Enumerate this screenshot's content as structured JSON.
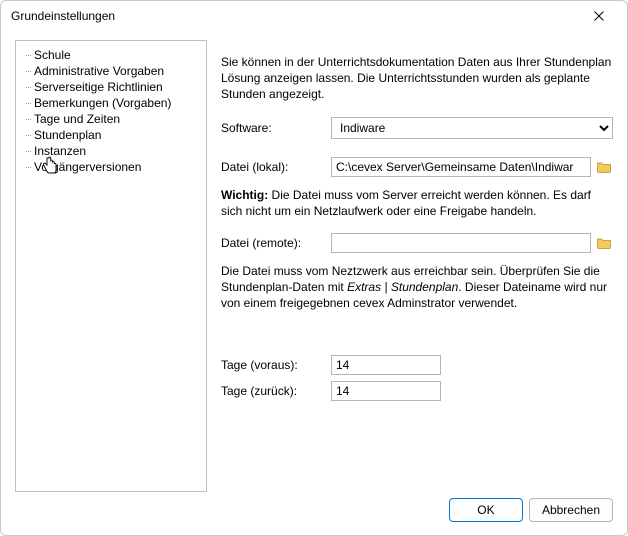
{
  "window": {
    "title": "Grundeinstellungen"
  },
  "nav": {
    "items": [
      {
        "label": "Schule"
      },
      {
        "label": "Administrative Vorgaben"
      },
      {
        "label": "Serverseitige Richtlinien"
      },
      {
        "label": "Bemerkungen (Vorgaben)"
      },
      {
        "label": "Tage und Zeiten"
      },
      {
        "label": "Stundenplan"
      },
      {
        "label": "Instanzen"
      },
      {
        "label": "Vorgängerversionen"
      }
    ],
    "selected_index": 5
  },
  "content": {
    "intro": "Sie können in der Unterrichtsdokumentation Daten aus Ihrer Stundenplan Lösung anzeigen lassen. Die Unterrichtsstunden wurden als geplante Stunden angezeigt.",
    "software_label": "Software:",
    "software_value": "Indiware",
    "file_local_label": "Datei (lokal):",
    "file_local_value": "C:\\cevex Server\\Gemeinsame Daten\\Indiwar",
    "note_local_strong": "Wichtig:",
    "note_local_rest": "  Die Datei muss vom Server erreicht werden können. Es darf sich nicht um ein Netzlaufwerk oder eine Freigabe handeln.",
    "file_remote_label": "Datei (remote):",
    "file_remote_value": "",
    "note_remote_pre": "Die Datei muss vom Neztzwerk aus erreichbar sein. Überprüfen Sie die Stundenplan-Daten mit ",
    "note_remote_em": "Extras | Stundenplan",
    "note_remote_post": ". Dieser Dateiname wird nur von einem freigegebnen cevex Adminstrator verwendet.",
    "days_ahead_label": "Tage (voraus):",
    "days_ahead_value": "14",
    "days_back_label": "Tage (zurück):",
    "days_back_value": "14"
  },
  "footer": {
    "ok": "OK",
    "cancel": "Abbrechen"
  }
}
